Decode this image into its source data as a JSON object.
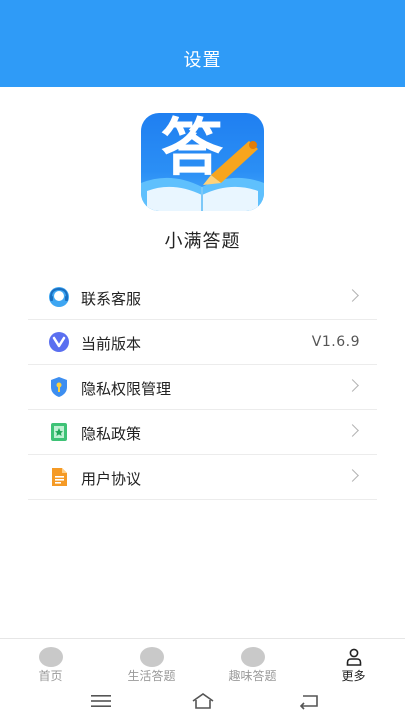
{
  "header": {
    "title": "设置"
  },
  "app": {
    "name": "小满答题",
    "logo_text": "答"
  },
  "menu": {
    "items": [
      {
        "label": "联系客服",
        "icon": "customer-service-icon",
        "has_chevron": true
      },
      {
        "label": "当前版本",
        "icon": "version-icon",
        "value": "V1.6.9"
      },
      {
        "label": "隐私权限管理",
        "icon": "privacy-shield-icon",
        "has_chevron": true
      },
      {
        "label": "隐私政策",
        "icon": "policy-bookmark-icon",
        "has_chevron": true
      },
      {
        "label": "用户协议",
        "icon": "agreement-document-icon",
        "has_chevron": true
      }
    ]
  },
  "tabbar": {
    "tabs": [
      {
        "label": "首页",
        "active": false
      },
      {
        "label": "生活答题",
        "active": false
      },
      {
        "label": "趣味答题",
        "active": false
      },
      {
        "label": "更多",
        "active": true
      }
    ]
  },
  "colors": {
    "header": "#2f9bf7",
    "inactive_tab": "#9a9a9a",
    "active_tab": "#222222"
  }
}
